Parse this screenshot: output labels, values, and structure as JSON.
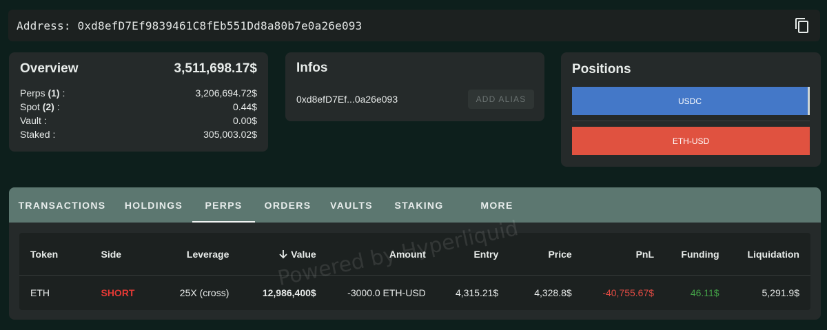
{
  "address_bar": {
    "text": "Address: 0xd8efD7Ef9839461C8fEb551Dd8a80b7e0a26e093",
    "copy_icon": "copy-icon"
  },
  "overview": {
    "title": "Overview",
    "total": "3,511,698.17$",
    "rows": [
      {
        "label_pre": "Perps ",
        "count": "(1)",
        "label_post": " :",
        "value": "3,206,694.72$"
      },
      {
        "label_pre": "Spot ",
        "count": "(2)",
        "label_post": " :",
        "value": "0.44$"
      },
      {
        "label_pre": "Vault :",
        "count": "",
        "label_post": "",
        "value": "0.00$"
      },
      {
        "label_pre": "Staked :",
        "count": "",
        "label_post": "",
        "value": "305,003.02$"
      }
    ]
  },
  "infos": {
    "title": "Infos",
    "short_address": "0xd8efD7Ef...0a26e093",
    "alias_button": "ADD ALIAS"
  },
  "positions": {
    "title": "Positions",
    "items": [
      {
        "label": "USDC",
        "color": "#4478c8"
      },
      {
        "label": "ETH-USD",
        "color": "#e05240"
      }
    ]
  },
  "tabs": [
    {
      "label": "TRANSACTIONS",
      "active": false
    },
    {
      "label": "HOLDINGS",
      "active": false
    },
    {
      "label": "PERPS",
      "active": true
    },
    {
      "label": "ORDERS",
      "active": false
    },
    {
      "label": "VAULTS",
      "active": false
    },
    {
      "label": "STAKING",
      "active": false
    },
    {
      "label": "MORE",
      "active": false
    }
  ],
  "table": {
    "headers": {
      "token": "Token",
      "side": "Side",
      "leverage": "Leverage",
      "value": "Value",
      "amount": "Amount",
      "entry": "Entry",
      "price": "Price",
      "pnl": "PnL",
      "funding": "Funding",
      "liquidation": "Liquidation"
    },
    "sort_icon": "arrow-down-icon",
    "rows": [
      {
        "token": "ETH",
        "side": "SHORT",
        "leverage": "25X (cross)",
        "value": "12,986,400$",
        "amount": "-3000.0 ETH-USD",
        "entry": "4,315.21$",
        "price": "4,328.8$",
        "pnl": "-40,755.67$",
        "funding": "46.11$",
        "liquidation": "5,291.9$"
      }
    ]
  },
  "watermark": "Powered by Hyperliquid",
  "colors": {
    "background": "#0d1f1c",
    "card": "#252a2a",
    "tab_bar": "#5c7770",
    "short": "#e53935",
    "negative": "#e04b43",
    "positive": "#43a047"
  }
}
